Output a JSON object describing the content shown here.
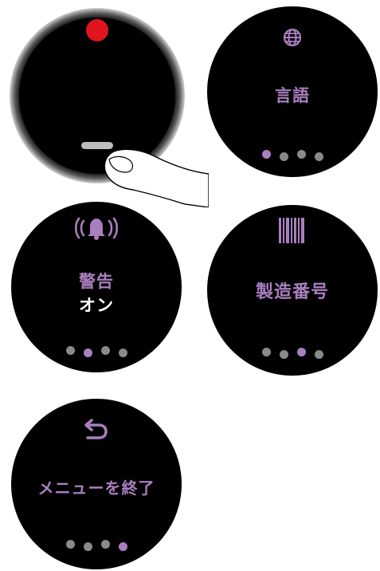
{
  "colors": {
    "accent": "#a97fbf",
    "inactive_dot": "#8a8a8a",
    "screen": "#000000",
    "record": "#e0141e"
  },
  "watch_press": {
    "record_dot": "record-icon",
    "button": "side-button"
  },
  "language": {
    "icon": "globe-icon",
    "label": "言語",
    "active_index": 0
  },
  "alert": {
    "icon": "bell-ringing-icon",
    "label": "警告",
    "value": "オン",
    "active_index": 1
  },
  "serial": {
    "icon": "barcode-icon",
    "label": "製造番号",
    "active_index": 2
  },
  "exit": {
    "icon": "return-arrow-icon",
    "label": "メニューを終了",
    "active_index": 3
  }
}
